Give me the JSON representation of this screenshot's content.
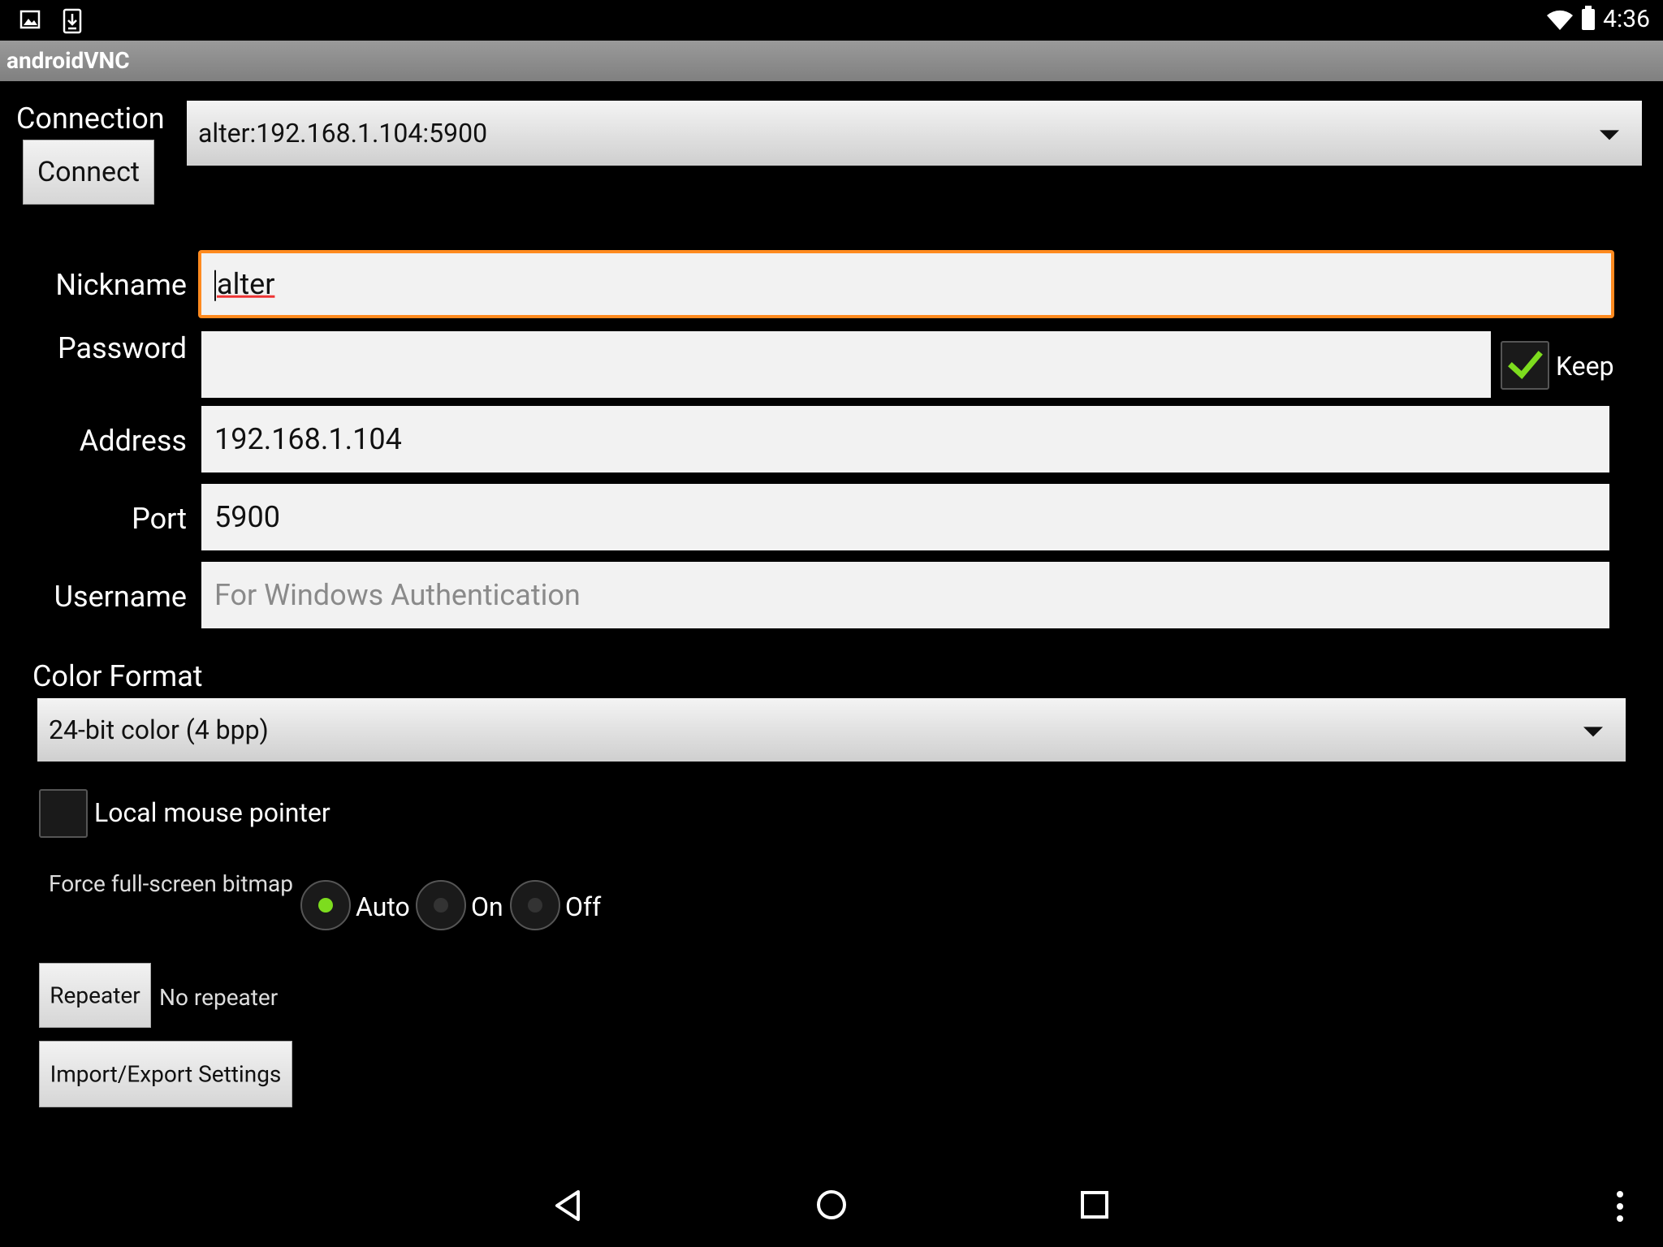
{
  "status_bar": {
    "time": "4:36",
    "icons": [
      "image-icon",
      "download-icon",
      "wifi-icon",
      "battery-icon"
    ]
  },
  "app": {
    "title": "androidVNC"
  },
  "connection": {
    "label": "Connection",
    "selected": "alter:192.168.1.104:5900",
    "connect_button": "Connect"
  },
  "form": {
    "nickname": {
      "label": "Nickname",
      "value": "alter"
    },
    "password": {
      "label": "Password",
      "value": "",
      "keep_label": "Keep",
      "keep_checked": true
    },
    "address": {
      "label": "Address",
      "value": "192.168.1.104"
    },
    "port": {
      "label": "Port",
      "value": "5900"
    },
    "username": {
      "label": "Username",
      "value": "",
      "placeholder": "For Windows Authentication"
    }
  },
  "color_format": {
    "label": "Color Format",
    "selected": "24-bit color (4 bpp)"
  },
  "local_mouse": {
    "label": "Local mouse pointer",
    "checked": false
  },
  "fullscreen_bitmap": {
    "label": "Force full-screen bitmap",
    "options": [
      "Auto",
      "On",
      "Off"
    ],
    "selected": "Auto"
  },
  "repeater": {
    "button": "Repeater",
    "status": "No repeater"
  },
  "import_export": {
    "button": "Import/Export Settings"
  },
  "colors": {
    "focus": "#ff8a1f",
    "check": "#7ddc1e"
  }
}
